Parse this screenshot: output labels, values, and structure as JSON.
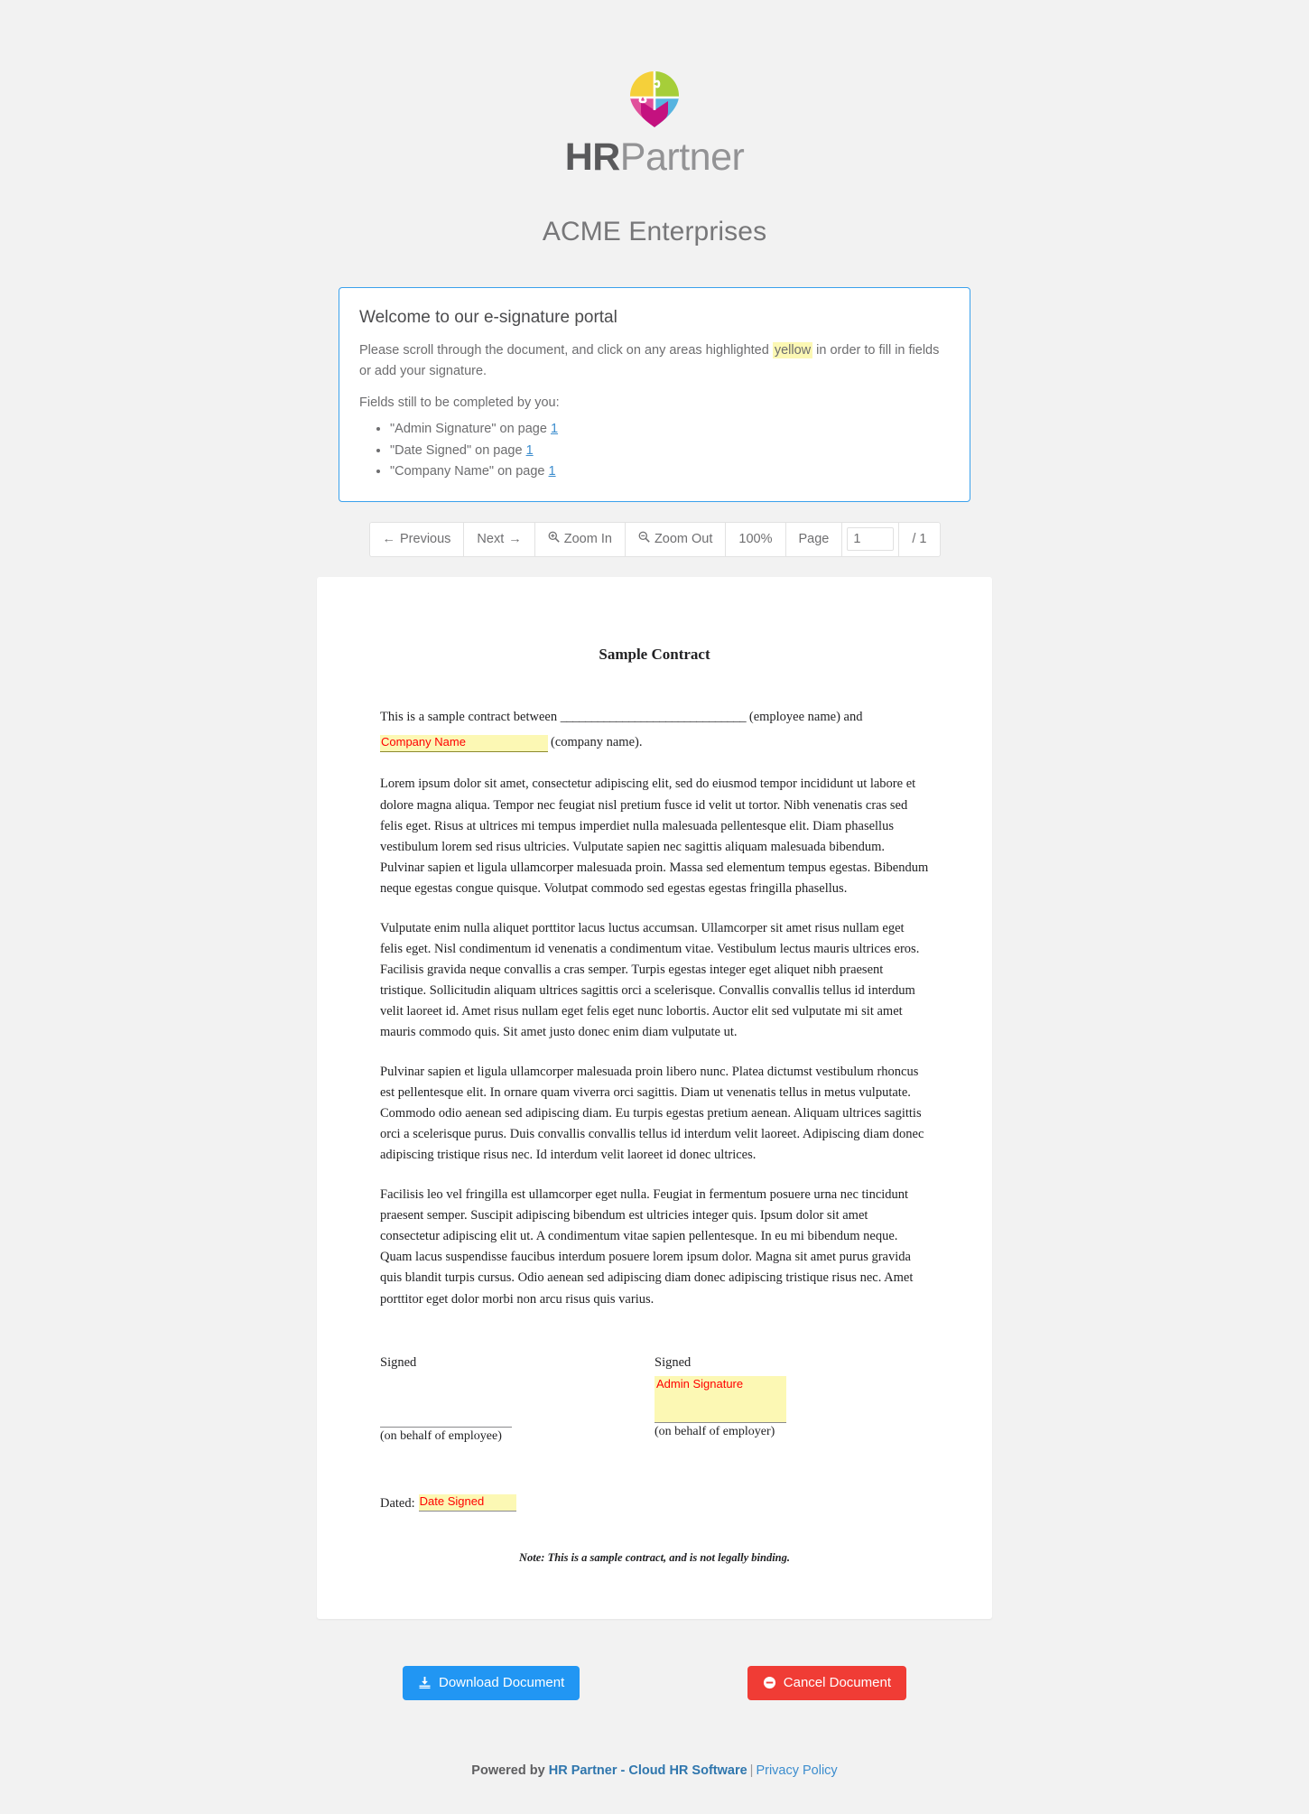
{
  "brand": {
    "logo_icon": "hrpartner-puzzle-pin-logo",
    "name_bold": "HR",
    "name_light": "Partner",
    "colors": {
      "green": "#a6ce39",
      "yellow": "#f5d03a",
      "blue": "#56b3e0",
      "pink": "#e0509b",
      "magenta": "#c4117f"
    }
  },
  "company_title": "ACME Enterprises",
  "welcome": {
    "heading": "Welcome to our e-signature portal",
    "intro_before": "Please scroll through the document, and click on any areas highlighted ",
    "intro_highlight": "yellow",
    "intro_after": " in order to fill in fields or add your signature.",
    "fields_lead": "Fields still to be completed by you:",
    "fields": [
      {
        "text": "\"Admin Signature\" on page ",
        "page": "1"
      },
      {
        "text": "\"Date Signed\" on page ",
        "page": "1"
      },
      {
        "text": "\"Company Name\" on page ",
        "page": "1"
      }
    ]
  },
  "toolbar": {
    "previous": "Previous",
    "previous_icon": "arrow-left-icon",
    "next": "Next",
    "next_icon": "arrow-right-icon",
    "zoom_in": "Zoom In",
    "zoom_in_icon": "magnifier-plus-icon",
    "zoom_out": "Zoom Out",
    "zoom_out_icon": "magnifier-minus-icon",
    "zoom_level": "100%",
    "page_label": "Page",
    "page_value": "1",
    "page_total": "/ 1"
  },
  "document": {
    "title": "Sample Contract",
    "intro_lead": "This is a sample contract between ",
    "intro_blank": "______________________________",
    "intro_mid": " (employee name) and",
    "intro_tail": "(company name).",
    "company_field_label": "Company Name",
    "paragraphs": [
      "Lorem ipsum dolor sit amet, consectetur adipiscing elit, sed do eiusmod tempor incididunt ut labore et dolore magna aliqua. Tempor nec feugiat nisl pretium fusce id velit ut tortor. Nibh venenatis cras sed felis eget. Risus at ultrices mi tempus imperdiet nulla malesuada pellentesque elit. Diam phasellus vestibulum lorem sed risus ultricies. Vulputate sapien nec sagittis aliquam malesuada bibendum. Pulvinar sapien et ligula ullamcorper malesuada proin. Massa sed elementum tempus egestas. Bibendum neque egestas congue quisque. Volutpat commodo sed egestas egestas fringilla phasellus.",
      "Vulputate enim nulla aliquet porttitor lacus luctus accumsan. Ullamcorper sit amet risus nullam eget felis eget. Nisl condimentum id venenatis a condimentum vitae. Vestibulum lectus mauris ultrices eros. Facilisis gravida neque convallis a cras semper. Turpis egestas integer eget aliquet nibh praesent tristique. Sollicitudin aliquam ultrices sagittis orci a scelerisque. Convallis convallis tellus id interdum velit laoreet id. Amet risus nullam eget felis eget nunc lobortis. Auctor elit sed vulputate mi sit amet mauris commodo quis. Sit amet justo donec enim diam vulputate ut.",
      "Pulvinar sapien et ligula ullamcorper malesuada proin libero nunc. Platea dictumst vestibulum rhoncus est pellentesque elit. In ornare quam viverra orci sagittis. Diam ut venenatis tellus in metus vulputate. Commodo odio aenean sed adipiscing diam. Eu turpis egestas pretium aenean. Aliquam ultrices sagittis orci a scelerisque purus. Duis convallis convallis tellus id interdum velit laoreet. Adipiscing diam donec adipiscing tristique risus nec. Id interdum velit laoreet id donec ultrices.",
      "Facilisis leo vel fringilla est ullamcorper eget nulla. Feugiat in fermentum posuere urna nec tincidunt praesent semper. Suscipit adipiscing bibendum est ultricies integer quis. Ipsum dolor sit amet consectetur adipiscing elit ut. A condimentum vitae sapien pellentesque. In eu mi bibendum neque. Quam lacus suspendisse faucibus interdum posuere lorem ipsum dolor. Magna sit amet purus gravida quis blandit turpis cursus. Odio aenean sed adipiscing diam donec adipiscing tristique risus nec. Amet porttitor eget dolor morbi non arcu risus quis varius."
    ],
    "signed_left_label": "Signed",
    "signed_left_caption": "(on behalf of employee)",
    "signed_right_label": "Signed",
    "signed_right_caption": "(on behalf of employer)",
    "admin_signature_field_label": "Admin Signature",
    "dated_label": "Dated:",
    "date_field_label": "Date Signed",
    "note": "Note: This is a sample contract, and is not legally binding."
  },
  "actions": {
    "download_label": "Download Document",
    "download_icon": "download-icon",
    "download_color": "#2196f3",
    "cancel_label": "Cancel Document",
    "cancel_icon": "minus-circle-icon",
    "cancel_color": "#f03c35"
  },
  "footer": {
    "powered_by": "Powered by ",
    "product_link": "HR Partner - Cloud HR Software",
    "separator": "|",
    "privacy_link": "Privacy Policy"
  }
}
